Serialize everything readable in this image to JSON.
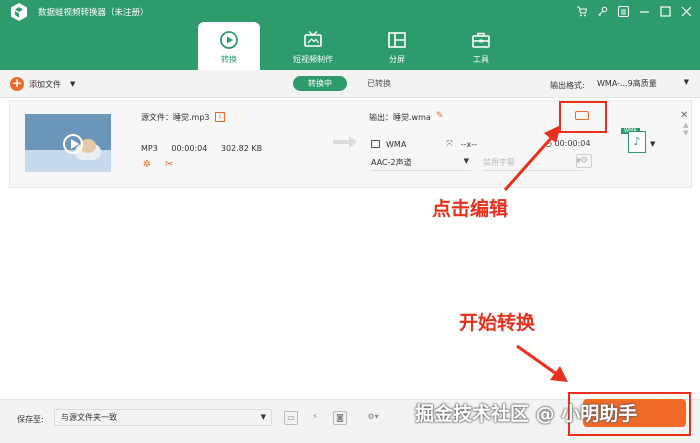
{
  "app": {
    "title": "数据蛙视频转换器（未注册）"
  },
  "window_icons": [
    "cart-icon",
    "key-icon",
    "menu-icon",
    "minimize-icon",
    "maximize-icon",
    "close-icon"
  ],
  "tabs": [
    {
      "label": "转换",
      "icon": "convert-icon",
      "active": true
    },
    {
      "label": "短视频制作",
      "icon": "tv-icon",
      "active": false
    },
    {
      "label": "分屏",
      "icon": "split-screen-icon",
      "active": false
    },
    {
      "label": "工具",
      "icon": "toolbox-icon",
      "active": false
    }
  ],
  "toolbar": {
    "add_label": "添加文件",
    "converting_label": "转换中",
    "converted_label": "已转换",
    "output_format_label": "输出格式:",
    "output_format_value": "WMA-...9高质量"
  },
  "file": {
    "source_name": "源文件：睡觉.mp3",
    "format": "MP3",
    "duration": "00:00:04",
    "size": "302.82 KB",
    "output_name": "输出：睡觉.wma",
    "output_format": "WMA",
    "resolution": "--x--",
    "output_duration": "00:00:04",
    "audio_channel": "AAC-2声道",
    "subtitle": "禁用字幕",
    "format_tag": "WMA"
  },
  "annotations": {
    "click_edit": "点击编辑",
    "start_convert": "开始转换"
  },
  "bottom": {
    "save_label": "保存至:",
    "save_path": "与源文件夹一致"
  },
  "watermark": "掘金技术社区 @ 小明助手",
  "colors": {
    "brand": "#2e9b6d",
    "accent": "#f06a28",
    "annotation": "#e8301c"
  }
}
